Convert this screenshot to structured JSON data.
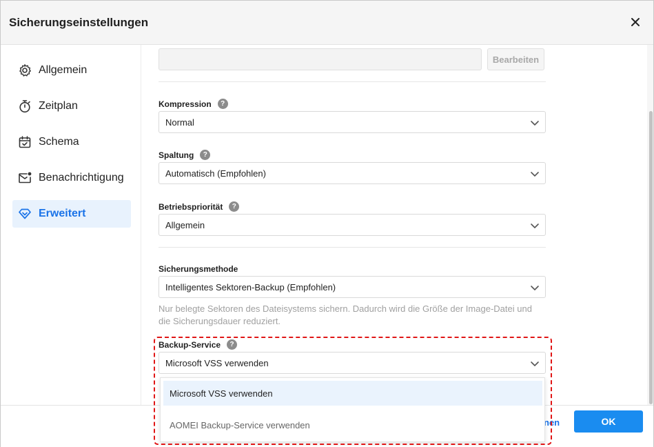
{
  "dialog": {
    "title": "Sicherungseinstellungen"
  },
  "sidebar": {
    "items": [
      {
        "label": "Allgemein",
        "icon": "gear-icon"
      },
      {
        "label": "Zeitplan",
        "icon": "stopwatch-icon"
      },
      {
        "label": "Schema",
        "icon": "calendar-check-icon"
      },
      {
        "label": "Benachrichtigung",
        "icon": "mail-notification-icon"
      },
      {
        "label": "Erweitert",
        "icon": "diamond-icon",
        "active": true
      }
    ]
  },
  "content": {
    "path_value": "",
    "edit_label": "Bearbeiten",
    "compression": {
      "label": "Kompression",
      "value": "Normal"
    },
    "splitting": {
      "label": "Spaltung",
      "value": "Automatisch (Empfohlen)"
    },
    "priority": {
      "label": "Betriebspriorität",
      "value": "Allgemein"
    },
    "method": {
      "label": "Sicherungsmethode",
      "value": "Intelligentes Sektoren-Backup (Empfohlen)",
      "hint": "Nur belegte Sektoren des Dateisystems sichern. Dadurch wird die Größe der Image-Datei und die Sicherungsdauer reduziert."
    },
    "backup_service": {
      "label": "Backup-Service",
      "value": "Microsoft VSS verwenden",
      "options": [
        "Microsoft VSS verwenden",
        "AOMEI Backup-Service verwenden"
      ]
    }
  },
  "footer": {
    "cancel_partial": "nen",
    "ok_label": "OK"
  },
  "colors": {
    "accent": "#1a73e8",
    "ok_button": "#1a8cf0",
    "active_nav_bg": "#e8f2fd",
    "highlight_border": "#e01515"
  }
}
